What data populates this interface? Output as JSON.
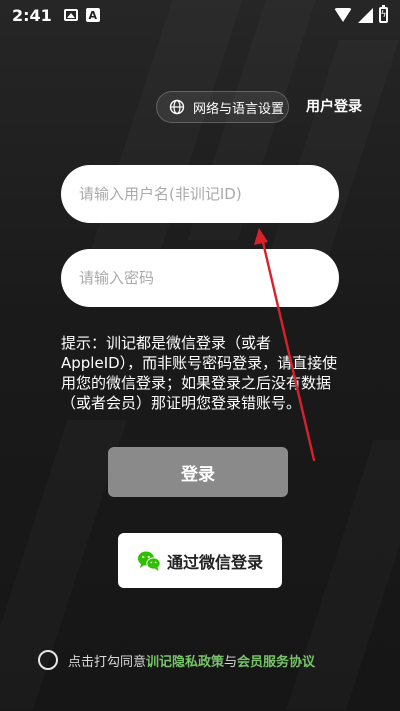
{
  "status_bar": {
    "time": "2:41",
    "app_icon_label": "A"
  },
  "header": {
    "network_language_label": "网络与语言设置",
    "user_login_label": "用户登录"
  },
  "form": {
    "username_placeholder": "请输入用户名(非训记ID)",
    "username_value": "",
    "password_placeholder": "请输入密码",
    "password_value": "",
    "hint_text": "提示：训记都是微信登录（或者AppleID），而非账号密码登录，请直接使用您的微信登录；如果登录之后没有数据（或者会员）那证明您登录错账号。",
    "login_label": "登录",
    "wechat_login_label": "通过微信登录"
  },
  "agreement": {
    "prefix": "点击打勾同意",
    "privacy_link": "训记隐私政策",
    "and": "与",
    "member_link": "会员服务协议",
    "checked": false
  },
  "colors": {
    "background": "#1c1c1c",
    "login_button": "#8a8a8a",
    "link_green": "#78c36a",
    "wechat_green": "#2dc100",
    "annotation_arrow": "#d8222b"
  },
  "icons": {
    "globe": "globe-icon",
    "wechat": "wechat-icon",
    "wifi": "wifi-icon",
    "signal": "signal-icon",
    "battery": "battery-charging-icon",
    "gallery": "image-icon"
  }
}
